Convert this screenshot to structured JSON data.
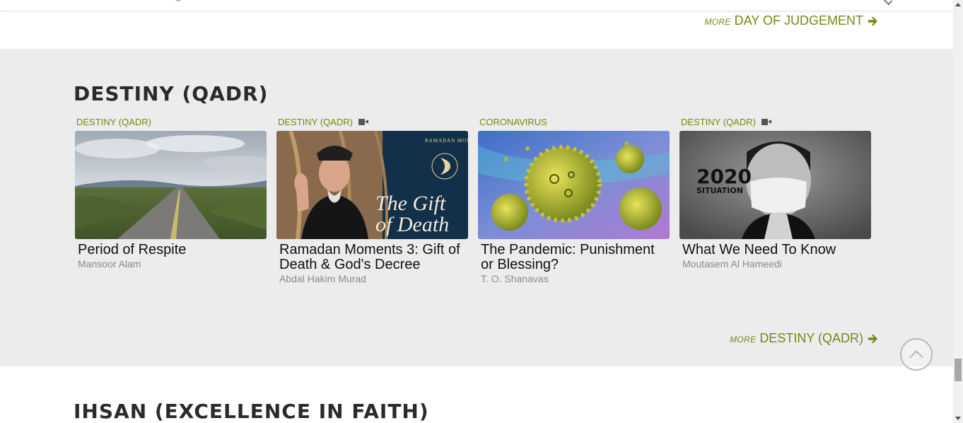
{
  "top_more": {
    "prefix": "MORE",
    "label": "DAY OF JUDGEMENT"
  },
  "destiny": {
    "title": "DESTINY (QADR)",
    "cards": [
      {
        "category": "DESTINY (QADR)",
        "video": false,
        "title": "Period of Respite",
        "author": "Mansoor Alam",
        "image": "road-landscape"
      },
      {
        "category": "DESTINY (QADR)",
        "video": true,
        "title": "Ramadan Moments 3: Gift of Death & God's Decree",
        "author": "Abdal Hakim Murad",
        "image": "speaker-gift-of-death",
        "overlay": {
          "series": "RAMADAN MOMENTS",
          "line1": "The Gift",
          "line2": "of Death"
        }
      },
      {
        "category": "CORONAVIRUS",
        "video": false,
        "title": "The Pandemic: Punishment or Blessing?",
        "author": "T. O. Shanavas",
        "image": "coronavirus-illustration"
      },
      {
        "category": "DESTINY (QADR)",
        "video": true,
        "title": "What We Need To Know",
        "author": "Moutasem Al Hameedi",
        "image": "masked-person-praying",
        "overlay": {
          "line1": "2020",
          "line2": "SITUATION"
        }
      }
    ],
    "more": {
      "prefix": "MORE",
      "label": "DESTINY (QADR)"
    }
  },
  "ihsan": {
    "title": "IHSAN (EXCELLENCE IN FAITH)"
  },
  "icons": {
    "more_arrow": "arrow-right-icon",
    "video": "video-camera-icon",
    "scroll_top": "chevron-up-icon"
  },
  "colors": {
    "accent": "#6f8c0f",
    "section_bg": "#ececec",
    "title": "#2a2a2a",
    "author": "#8a8a8a"
  }
}
